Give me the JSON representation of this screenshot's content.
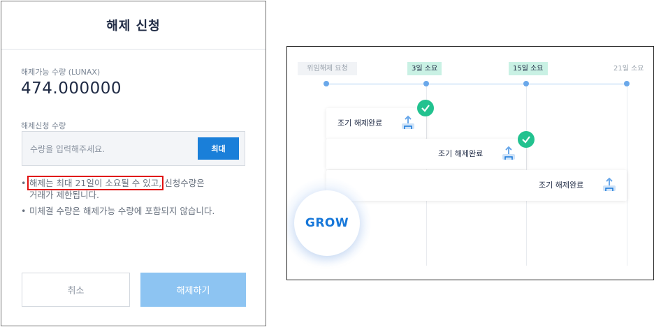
{
  "modal": {
    "title": "해제 신청",
    "available_label": "해제가능 수량 (LUNAX)",
    "available_value": "474.000000",
    "request_label": "해제신청 수량",
    "input_placeholder": "수량을 입력해주세요.",
    "input_value": "",
    "max_label": "최대",
    "notes": {
      "note1_highlight": "해제는 최대 21일이 소요될 수 있고,",
      "note1_rest_a": "신청수량은",
      "note1_rest_b": "거래가 제한됩니다.",
      "note2": "미체결 수량은 해제가능 수량에 포함되지 않습니다."
    },
    "cancel_label": "취소",
    "submit_label": "해제하기"
  },
  "timeline": {
    "markers": {
      "start": "위임해제 요청",
      "day3": "3일 소요",
      "day15": "15일 소요",
      "day21": "21일 소요"
    },
    "cards": [
      {
        "label": "조기 해제완료",
        "checked": true
      },
      {
        "label": "조기 해제완료",
        "checked": true
      },
      {
        "label": "조기 해제완료",
        "checked": false
      }
    ],
    "badge": "GROW"
  },
  "colors": {
    "primary": "#1a7fd9",
    "submit_disabled": "#8dc4f2",
    "highlight_border": "#e01010",
    "check_green": "#22c28f",
    "tag_green_bg": "#c9f1e4",
    "timeline_blue": "#6aa8ea"
  },
  "icons": {
    "check": "check-circle-icon",
    "card": "unlock-tray-icon"
  }
}
